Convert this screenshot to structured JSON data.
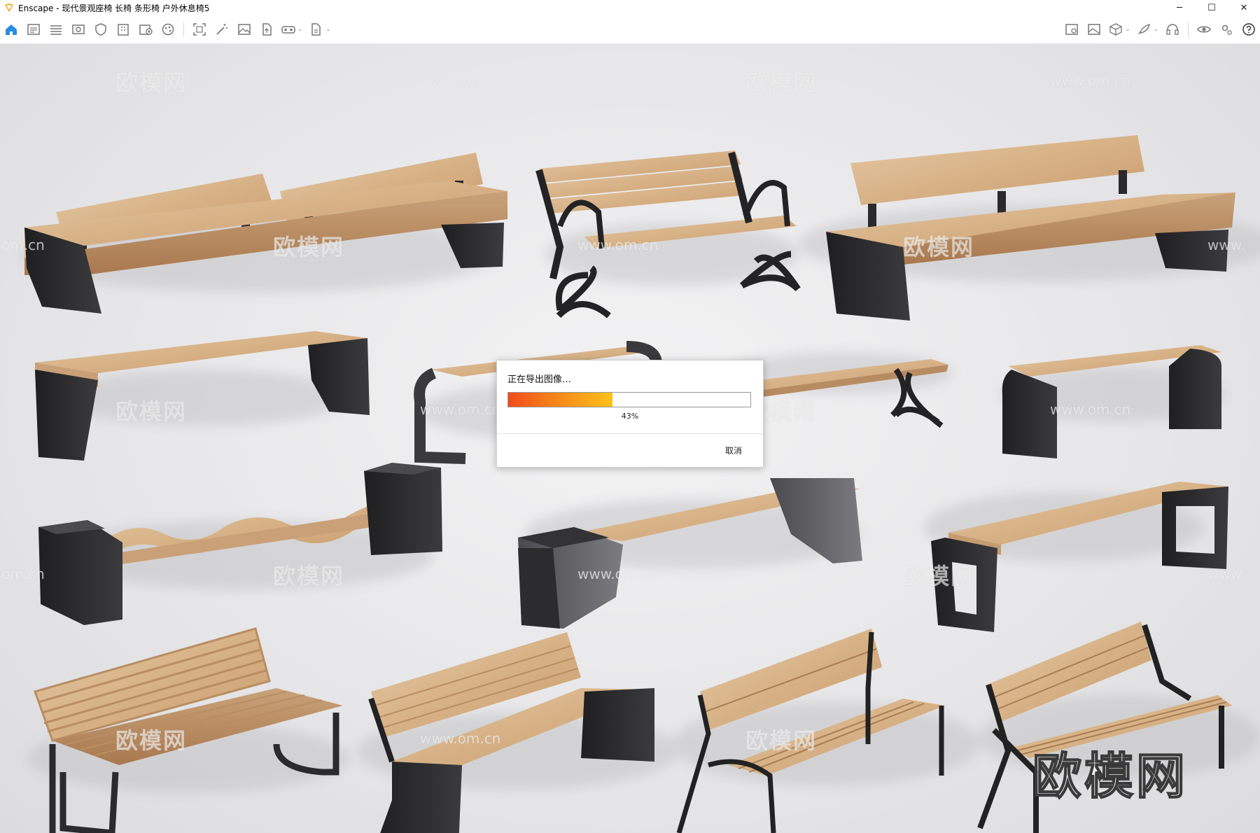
{
  "window": {
    "title": "Enscape - 现代景观座椅 长椅 条形椅 户外休息椅5",
    "minimize": "─",
    "maximize": "☐",
    "close": "✕"
  },
  "toolbar": {
    "left_icons": [
      "home-icon",
      "project-icon",
      "visual-settings-icon",
      "view-icon",
      "shield-icon",
      "building-icon",
      "add-object-icon",
      "palette-icon",
      "screenshot-icon",
      "magic-icon",
      "image-icon",
      "upload-icon",
      "vr-icon",
      "export-icon"
    ],
    "right_icons": [
      "map-icon",
      "gallery-icon",
      "cube-icon",
      "feather-icon",
      "headset-icon",
      "eye-icon",
      "settings-icon",
      "help-icon"
    ],
    "collapse_glyph": "⌃"
  },
  "watermarks": {
    "site_cn": "欧模网",
    "site_url": "www.om.cn",
    "site_url_partial": "om.cn",
    "site_url_right": "www.",
    "big_logo": "欧模网"
  },
  "export_dialog": {
    "title": "正在导出图像…",
    "progress": 0.43,
    "percent_text": "43%",
    "cancel_label": "取消"
  },
  "colors": {
    "wood": "#d9b48a",
    "metal": "#2b2b2d",
    "progress_start": "#f04a1a",
    "progress_end": "#ffc21a"
  }
}
